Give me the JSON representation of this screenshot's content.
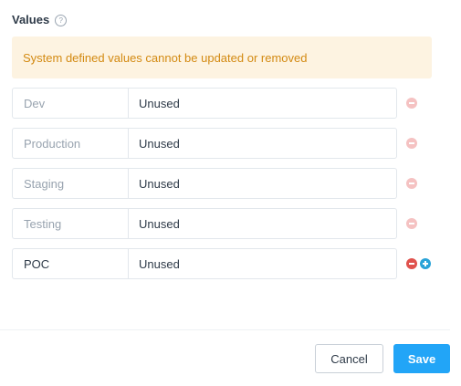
{
  "section": {
    "title": "Values",
    "help_icon": "question-circle-icon"
  },
  "warning": {
    "text": "System defined values cannot be updated or removed"
  },
  "rows": [
    {
      "name": "Dev",
      "value": "Unused",
      "system_defined": true
    },
    {
      "name": "Production",
      "value": "Unused",
      "system_defined": true
    },
    {
      "name": "Staging",
      "value": "Unused",
      "system_defined": true
    },
    {
      "name": "Testing",
      "value": "Unused",
      "system_defined": true
    },
    {
      "name": "POC",
      "value": "Unused",
      "system_defined": false
    }
  ],
  "footer": {
    "cancel_label": "Cancel",
    "save_label": "Save"
  },
  "colors": {
    "warning_bg": "#fdf3e1",
    "warning_text": "#d38a12",
    "primary": "#22a5f7",
    "remove_active": "#e0524d",
    "remove_disabled": "#f5c2c2",
    "add": "#2aa3d8"
  }
}
